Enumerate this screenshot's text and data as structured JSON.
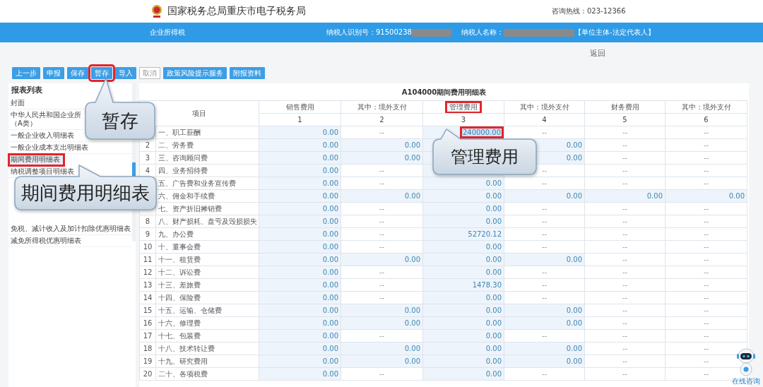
{
  "header": {
    "title": "国家税务总局重庆市电子税务局",
    "hotline": "咨询热线：023-12366"
  },
  "info_bar": {
    "tax_type": "企业所得税",
    "taxpayer_id": "纳税人识别号：91500238",
    "taxpayer_name": "纳税人名称：",
    "role": "【单位主体-法定代表人】"
  },
  "back_link": "返回",
  "toolbar": [
    {
      "label": "上一步",
      "disabled": false,
      "highlighted": false
    },
    {
      "label": "申报",
      "disabled": false,
      "highlighted": false
    },
    {
      "label": "保存",
      "disabled": false,
      "highlighted": false
    },
    {
      "label": "暂存",
      "disabled": false,
      "highlighted": true
    },
    {
      "label": "导入",
      "disabled": false,
      "highlighted": false
    },
    {
      "label": "取消",
      "disabled": true,
      "highlighted": false
    },
    {
      "label": "政策风险提示服务",
      "disabled": false,
      "highlighted": false
    },
    {
      "label": "附报资料",
      "disabled": false,
      "highlighted": false
    }
  ],
  "sidebar": {
    "title": "报表列表",
    "sections": [
      {
        "items": [
          {
            "label": "封面",
            "selected": false,
            "highlighted": false
          },
          {
            "label": "中华人民共和国企业所（A类）",
            "selected": false,
            "highlighted": false
          },
          {
            "label": "一般企业收入明细表",
            "selected": false,
            "highlighted": false
          },
          {
            "label": "一般企业成本支出明细表",
            "selected": false,
            "highlighted": false
          },
          {
            "label": "期间费用明细表",
            "selected": true,
            "highlighted": true
          },
          {
            "label": "纳税调整项目明细表",
            "selected": false,
            "highlighted": false
          }
        ]
      },
      {
        "items": [
          {
            "label": "免税、减计收入及加计扣除优惠明细表",
            "selected": false,
            "highlighted": false
          },
          {
            "label": "减免所得税优惠明细表",
            "selected": false,
            "highlighted": false
          }
        ]
      }
    ]
  },
  "table": {
    "title": "A104000期间费用明细表",
    "item_header": "项目",
    "columns": [
      {
        "label": "销售费用",
        "number": "1",
        "highlighted": false
      },
      {
        "label": "其中：境外支付",
        "number": "2",
        "highlighted": false
      },
      {
        "label": "管理费用",
        "number": "3",
        "highlighted": true
      },
      {
        "label": "其中：境外支付",
        "number": "4",
        "highlighted": false
      },
      {
        "label": "财务费用",
        "number": "5",
        "highlighted": false
      },
      {
        "label": "其中：境外支付",
        "number": "6",
        "highlighted": false
      }
    ],
    "rows": [
      {
        "item": "一、职工薪酬",
        "cells": [
          {
            "text": "0.00",
            "editable": true
          },
          {
            "text": "--",
            "editable": false
          },
          {
            "text": "240000.00",
            "editable": true,
            "highlighted": true
          },
          {
            "text": "--",
            "editable": false
          },
          {
            "text": "--",
            "editable": false
          },
          {
            "text": "--",
            "editable": false
          }
        ]
      },
      {
        "no": "2",
        "item": "二、劳务费",
        "cells": [
          {
            "text": "0.00",
            "editable": true
          },
          {
            "text": "0.00",
            "editable": true
          },
          {
            "editable": true
          },
          {
            "text": "0.00",
            "editable": true
          },
          {
            "text": "--",
            "editable": false
          },
          {
            "text": "--",
            "editable": false
          }
        ]
      },
      {
        "no": "3",
        "item": "三、咨询顾问费",
        "cells": [
          {
            "text": "0.00",
            "editable": true
          },
          {
            "text": "0.00",
            "editable": true
          },
          {
            "editable": true
          },
          {
            "text": "0.00",
            "editable": true
          },
          {
            "text": "--",
            "editable": false
          },
          {
            "text": "--",
            "editable": false
          }
        ]
      },
      {
        "no": "4",
        "item": "四、业务招待费",
        "cells": [
          {
            "text": "0.00",
            "editable": true
          },
          {
            "text": "--",
            "editable": false
          },
          {
            "editable": true
          },
          {
            "text": "--",
            "editable": false
          },
          {
            "text": "--",
            "editable": false
          },
          {
            "text": "--",
            "editable": false
          }
        ]
      },
      {
        "item": "五、广告费和业务宣传费",
        "cells": [
          {
            "text": "0.00",
            "editable": true
          },
          {
            "text": "--",
            "editable": false
          },
          {
            "text": "0.00",
            "editable": true
          },
          {
            "text": "--",
            "editable": false
          },
          {
            "text": "--",
            "editable": false
          },
          {
            "text": "--",
            "editable": false
          }
        ]
      },
      {
        "item": "六、佣金和手续费",
        "cells": [
          {
            "text": "0.00",
            "editable": true
          },
          {
            "text": "0.00",
            "editable": true
          },
          {
            "text": "0.00",
            "editable": true
          },
          {
            "text": "0.00",
            "editable": true
          },
          {
            "text": "0.00",
            "editable": true
          },
          {
            "text": "0.00",
            "editable": true
          }
        ]
      },
      {
        "item": "七、资产折旧摊销费",
        "cells": [
          {
            "text": "0.00",
            "editable": true
          },
          {
            "text": "--",
            "editable": false
          },
          {
            "text": "0.00",
            "editable": true
          },
          {
            "text": "--",
            "editable": false
          },
          {
            "text": "--",
            "editable": false
          },
          {
            "text": "--",
            "editable": false
          }
        ]
      },
      {
        "no": "8",
        "item": "八、财产损耗、盘亏及毁损损失",
        "cells": [
          {
            "text": "0.00",
            "editable": true
          },
          {
            "text": "--",
            "editable": false
          },
          {
            "text": "0.00",
            "editable": true
          },
          {
            "text": "--",
            "editable": false
          },
          {
            "text": "--",
            "editable": false
          },
          {
            "text": "--",
            "editable": false
          }
        ]
      },
      {
        "no": "9",
        "item": "九、办公费",
        "cells": [
          {
            "text": "0.00",
            "editable": true
          },
          {
            "text": "--",
            "editable": false
          },
          {
            "text": "52720.12",
            "editable": true
          },
          {
            "text": "--",
            "editable": false
          },
          {
            "text": "--",
            "editable": false
          },
          {
            "text": "--",
            "editable": false
          }
        ]
      },
      {
        "no": "10",
        "item": "十、董事会费",
        "cells": [
          {
            "text": "0.00",
            "editable": true
          },
          {
            "text": "--",
            "editable": false
          },
          {
            "text": "0.00",
            "editable": true
          },
          {
            "text": "--",
            "editable": false
          },
          {
            "text": "--",
            "editable": false
          },
          {
            "text": "--",
            "editable": false
          }
        ]
      },
      {
        "no": "11",
        "item": "十一、租赁费",
        "cells": [
          {
            "text": "0.00",
            "editable": true
          },
          {
            "text": "0.00",
            "editable": true
          },
          {
            "text": "0.00",
            "editable": true
          },
          {
            "text": "0.00",
            "editable": true
          },
          {
            "text": "--",
            "editable": false
          },
          {
            "text": "--",
            "editable": false
          }
        ]
      },
      {
        "no": "12",
        "item": "十二、诉讼费",
        "cells": [
          {
            "text": "0.00",
            "editable": true
          },
          {
            "text": "--",
            "editable": false
          },
          {
            "text": "0.00",
            "editable": true
          },
          {
            "text": "--",
            "editable": false
          },
          {
            "text": "--",
            "editable": false
          },
          {
            "text": "--",
            "editable": false
          }
        ]
      },
      {
        "no": "13",
        "item": "十三、差旅费",
        "cells": [
          {
            "text": "0.00",
            "editable": true
          },
          {
            "text": "--",
            "editable": false
          },
          {
            "text": "1478.30",
            "editable": true
          },
          {
            "text": "--",
            "editable": false
          },
          {
            "text": "--",
            "editable": false
          },
          {
            "text": "--",
            "editable": false
          }
        ]
      },
      {
        "no": "14",
        "item": "十四、保险费",
        "cells": [
          {
            "text": "0.00",
            "editable": true
          },
          {
            "text": "--",
            "editable": false
          },
          {
            "text": "0.00",
            "editable": true
          },
          {
            "text": "--",
            "editable": false
          },
          {
            "text": "--",
            "editable": false
          },
          {
            "text": "--",
            "editable": false
          }
        ]
      },
      {
        "no": "15",
        "item": "十五、运输、仓储费",
        "cells": [
          {
            "text": "0.00",
            "editable": true
          },
          {
            "text": "0.00",
            "editable": true
          },
          {
            "text": "0.00",
            "editable": true
          },
          {
            "text": "0.00",
            "editable": true
          },
          {
            "text": "--",
            "editable": false
          },
          {
            "text": "--",
            "editable": false
          }
        ]
      },
      {
        "no": "16",
        "item": "十六、修理费",
        "cells": [
          {
            "text": "0.00",
            "editable": true
          },
          {
            "text": "0.00",
            "editable": true
          },
          {
            "text": "0.00",
            "editable": true
          },
          {
            "text": "0.00",
            "editable": true
          },
          {
            "text": "--",
            "editable": false
          },
          {
            "text": "--",
            "editable": false
          }
        ]
      },
      {
        "no": "17",
        "item": "十七、包装费",
        "cells": [
          {
            "text": "0.00",
            "editable": true
          },
          {
            "text": "--",
            "editable": false
          },
          {
            "text": "0.00",
            "editable": true
          },
          {
            "text": "--",
            "editable": false
          },
          {
            "text": "--",
            "editable": false
          },
          {
            "text": "--",
            "editable": false
          }
        ]
      },
      {
        "no": "18",
        "item": "十八、技术转让费",
        "cells": [
          {
            "text": "0.00",
            "editable": true
          },
          {
            "text": "0.00",
            "editable": true
          },
          {
            "text": "0.00",
            "editable": true
          },
          {
            "text": "0.00",
            "editable": true
          },
          {
            "text": "--",
            "editable": false
          },
          {
            "text": "--",
            "editable": false
          }
        ]
      },
      {
        "no": "19",
        "item": "十九、研究费用",
        "cells": [
          {
            "text": "0.00",
            "editable": true
          },
          {
            "text": "0.00",
            "editable": true
          },
          {
            "text": "0.00",
            "editable": true
          },
          {
            "text": "0.00",
            "editable": true
          },
          {
            "text": "--",
            "editable": false
          },
          {
            "text": "--",
            "editable": false
          }
        ]
      },
      {
        "no": "20",
        "item": "二十、各项税费",
        "cells": [
          {
            "text": "0.00",
            "editable": true
          },
          {
            "text": "--",
            "editable": false
          },
          {
            "text": "0.00",
            "editable": true
          },
          {
            "text": "--",
            "editable": false
          },
          {
            "text": "--",
            "editable": false
          },
          {
            "text": "--",
            "editable": false
          }
        ]
      }
    ]
  },
  "callouts": [
    {
      "text": "暂存"
    },
    {
      "text": "管理费用"
    },
    {
      "text": "期间费用明细表"
    }
  ],
  "chat": {
    "label": "在线咨询"
  }
}
